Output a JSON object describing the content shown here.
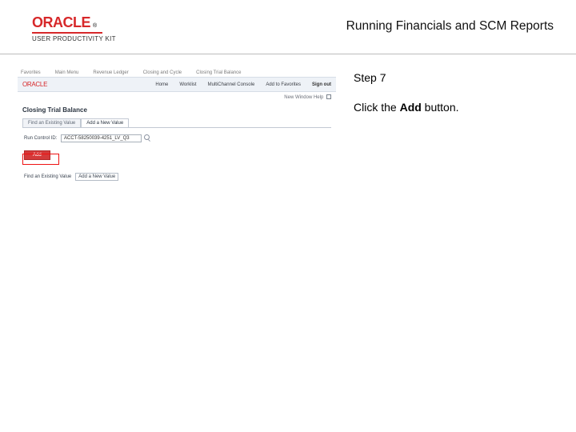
{
  "header": {
    "brand_word": "ORACLE",
    "brand_tm": "®",
    "brand_subtitle": "USER PRODUCTIVITY KIT",
    "doc_title": "Running Financials and SCM Reports"
  },
  "instruction": {
    "step_label": "Step 7",
    "line_prefix": "Click the ",
    "line_bold": "Add",
    "line_suffix": " button."
  },
  "screenshot": {
    "top_tabs": [
      "Favorites",
      "Main Menu",
      "Revenue Ledger",
      "Closing and Cycle",
      "Closing Trial Balance"
    ],
    "mini_logo": "ORACLE",
    "subnav_links": [
      "Home",
      "Worklist",
      "MultiChannel Console",
      "Add to Favorites"
    ],
    "signout": "Sign out",
    "new_window": "New Window   Help",
    "page_title": "Closing Trial Balance",
    "inner_tabs": [
      "Find an Existing Value",
      "Add a New Value"
    ],
    "run_control_label": "Run Control ID:",
    "run_control_value": "ACCT-58250039-4251_LV_Q3",
    "add_button": "Add",
    "search_label": "Find an Existing Value",
    "search_field": "Add a New Value"
  }
}
